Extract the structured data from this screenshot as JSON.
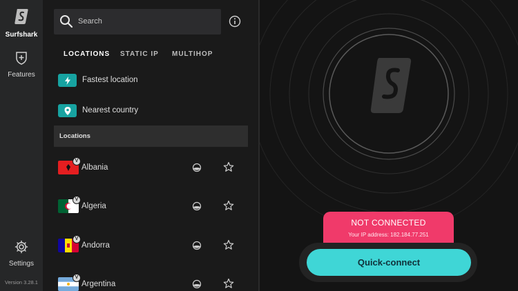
{
  "sidebar": {
    "brand_label": "Surfshark",
    "features_label": "Features",
    "settings_label": "Settings",
    "version": "Version 3.28.1"
  },
  "search": {
    "placeholder": "Search"
  },
  "tabs": [
    {
      "label": "LOCATIONS",
      "active": true
    },
    {
      "label": "STATIC IP",
      "active": false
    },
    {
      "label": "MULTIHOP",
      "active": false
    }
  ],
  "quick": {
    "fastest": "Fastest location",
    "nearest": "Nearest country"
  },
  "section_header": "Locations",
  "locations": [
    {
      "name": "Albania",
      "badge": "V",
      "icon_names": [
        "flag-albania-icon",
        "ping-icon",
        "star-icon"
      ]
    },
    {
      "name": "Algeria",
      "badge": "V",
      "icon_names": [
        "flag-algeria-icon",
        "ping-icon",
        "star-icon"
      ]
    },
    {
      "name": "Andorra",
      "badge": "V",
      "icon_names": [
        "flag-andorra-icon",
        "ping-icon",
        "star-icon"
      ]
    },
    {
      "name": "Argentina",
      "badge": "V",
      "icon_names": [
        "flag-argentina-icon",
        "ping-icon",
        "star-icon"
      ]
    }
  ],
  "status": {
    "title": "NOT CONNECTED",
    "ip_text": "Your IP address: 182.184.77.251"
  },
  "quick_connect_label": "Quick-connect",
  "colors": {
    "accent_teal": "#3fd6d6",
    "status_red": "#f03a6a",
    "quick_icon_teal": "#17a3a1"
  }
}
